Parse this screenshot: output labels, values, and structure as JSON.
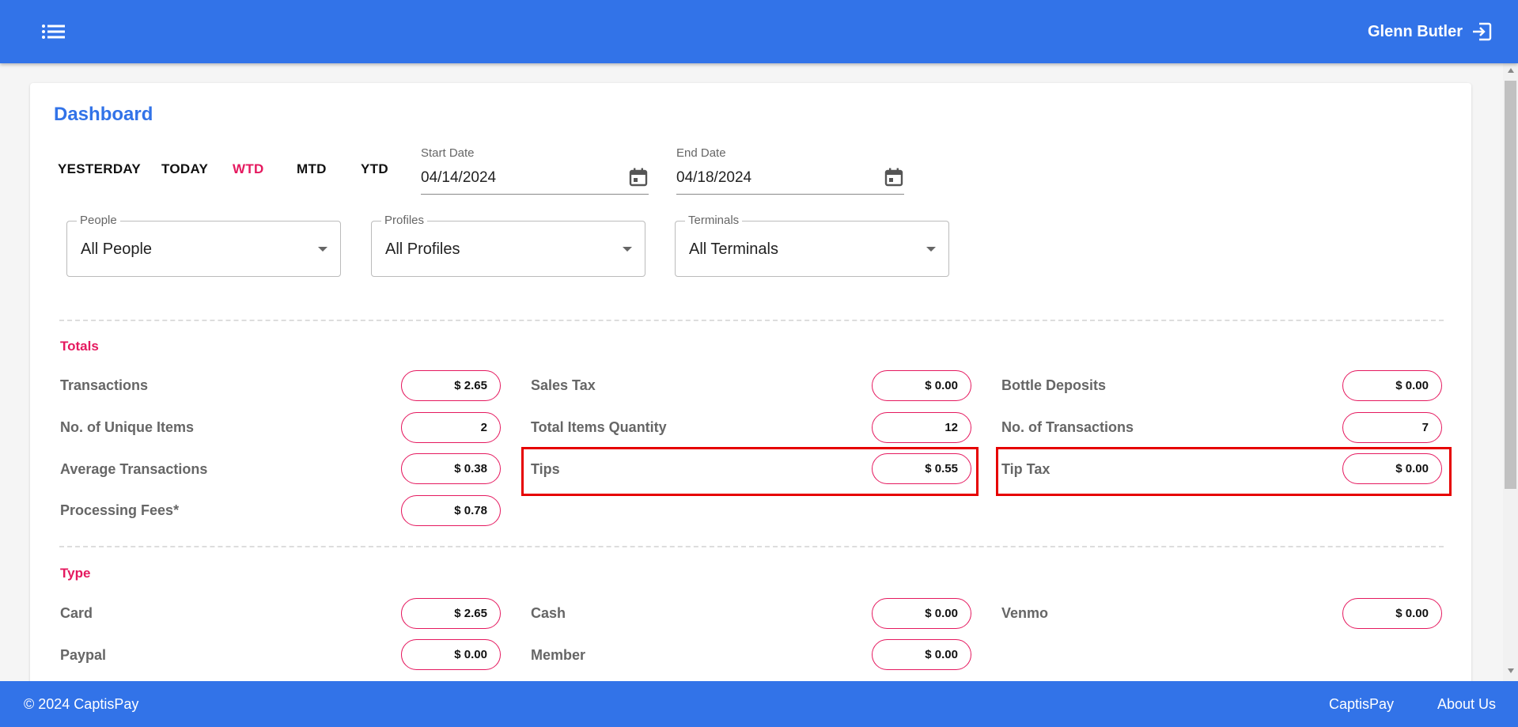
{
  "header": {
    "menu_icon": "list-menu-icon",
    "user_name": "Glenn Butler",
    "logout_icon": "logout-icon"
  },
  "page": {
    "title": "Dashboard"
  },
  "filters": {
    "ranges": [
      "YESTERDAY",
      "TODAY",
      "WTD",
      "MTD",
      "YTD"
    ],
    "active_range": "WTD",
    "start_date": {
      "label": "Start Date",
      "value": "04/14/2024"
    },
    "end_date": {
      "label": "End Date",
      "value": "04/18/2024"
    },
    "people": {
      "label": "People",
      "value": "All People"
    },
    "profiles": {
      "label": "Profiles",
      "value": "All Profiles"
    },
    "terminals": {
      "label": "Terminals",
      "value": "All Terminals"
    }
  },
  "totals": {
    "title": "Totals",
    "items": [
      {
        "label": "Transactions",
        "value": "$ 2.65"
      },
      {
        "label": "Sales Tax",
        "value": "$ 0.00"
      },
      {
        "label": "Bottle Deposits",
        "value": "$ 0.00"
      },
      {
        "label": "No. of Unique Items",
        "value": "2"
      },
      {
        "label": "Total Items Quantity",
        "value": "12"
      },
      {
        "label": "No. of Transactions",
        "value": "7"
      },
      {
        "label": "Average Transactions",
        "value": "$ 0.38"
      },
      {
        "label": "Tips",
        "value": "$ 0.55"
      },
      {
        "label": "Tip Tax",
        "value": "$ 0.00"
      },
      {
        "label": "Processing Fees*",
        "value": "$ 0.78"
      }
    ]
  },
  "type": {
    "title": "Type",
    "items": [
      {
        "label": "Card",
        "value": "$ 2.65"
      },
      {
        "label": "Cash",
        "value": "$ 0.00"
      },
      {
        "label": "Venmo",
        "value": "$ 0.00"
      },
      {
        "label": "Paypal",
        "value": "$ 0.00"
      },
      {
        "label": "Member",
        "value": "$ 0.00"
      }
    ]
  },
  "footer": {
    "copyright": "© 2024 CaptisPay",
    "links": [
      "CaptisPay",
      "About Us"
    ]
  },
  "colors": {
    "primary": "#3273e8",
    "accent": "#e5195f",
    "highlight": "#e60000"
  }
}
